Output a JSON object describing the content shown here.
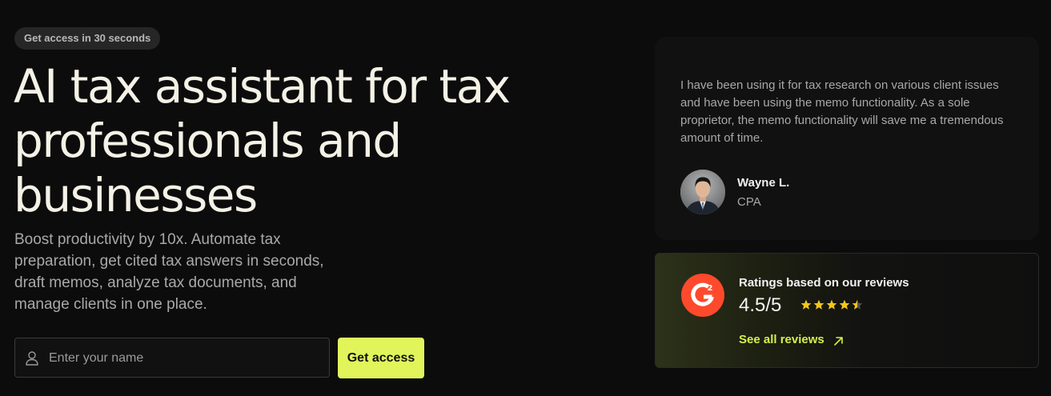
{
  "hero": {
    "badge": "Get access in 30 seconds",
    "headline": "AI tax assistant for tax professionals and businesses",
    "subtitle": "Boost productivity by 10x. Automate tax preparation, get cited tax answers in seconds, draft memos, analyze tax documents, and manage clients in one place."
  },
  "signup": {
    "name_placeholder": "Enter your name",
    "name_value": "",
    "icon": "user-icon",
    "button_label": "Get access"
  },
  "testimonial": {
    "quote": "I have been using it for tax research on various client issues and have been using the memo functionality. As a sole proprietor, the memo functionality will save me a tremendous amount of time.",
    "author": "Wayne L.",
    "role": "CPA"
  },
  "ratings": {
    "title": "Ratings based on our reviews",
    "score": "4.5/5",
    "stars_value": 4.5,
    "stars_max": 5,
    "link_label": "See all reviews",
    "link_icon": "arrow-up-right-icon",
    "logo": "g2-logo"
  },
  "colors": {
    "background": "#0c0c0c",
    "accent": "#e1f55b",
    "link": "#d6ef4d",
    "star": "#f5c518",
    "g2_red": "#ff492c"
  }
}
